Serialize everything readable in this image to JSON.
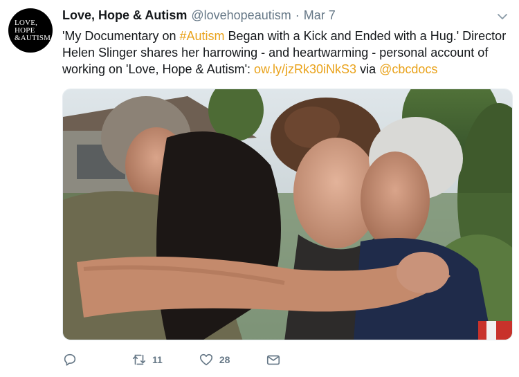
{
  "tweet": {
    "avatar": {
      "lines": [
        "LOVE,",
        "HOPE",
        "&AUTISM"
      ]
    },
    "author_name": "Love, Hope & Autism",
    "handle": "@lovehopeautism",
    "separator": "·",
    "time": "Mar 7",
    "text": {
      "part1": "'My Documentary on ",
      "hashtag": "#Autism",
      "part2": " Began with a Kick and Ended with a Hug.' Director Helen Slinger shares her harrowing - and heartwarming - personal account of working on 'Love, Hope & Autism': ",
      "link": "ow.ly/jzRk30iNkS3",
      "part3": " via ",
      "mention": "@cbcdocs"
    },
    "actions": {
      "reply_icon": "reply-icon",
      "retweet_icon": "retweet-icon",
      "retweet_count": "11",
      "like_icon": "heart-icon",
      "like_count": "28",
      "dm_icon": "envelope-icon"
    }
  },
  "colors": {
    "link": "#e9a21a",
    "secondary_text": "#657786"
  }
}
